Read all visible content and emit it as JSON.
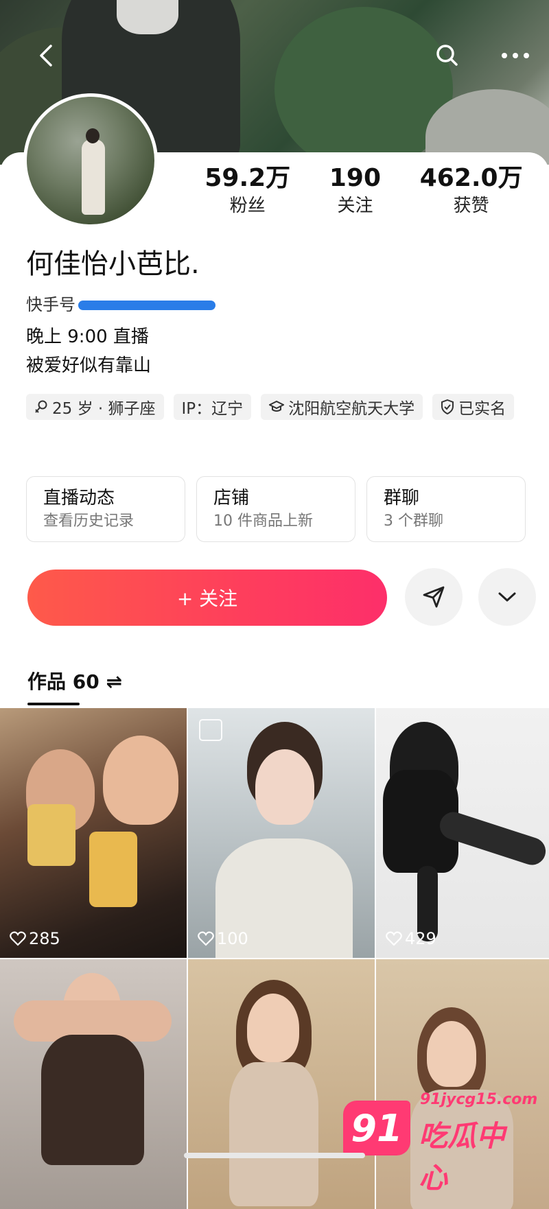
{
  "header": {
    "back_icon": "chevron-left-icon",
    "search_icon": "search-icon",
    "more_icon": "more-dots-icon"
  },
  "profile": {
    "name": "何佳怡小芭比.",
    "kuaishou_id_label": "快手号",
    "bio_lines": [
      "晚上 9:00 直播",
      "被爱好似有靠山"
    ],
    "stats": [
      {
        "value": "59.2万",
        "label": "粉丝"
      },
      {
        "value": "190",
        "label": "关注"
      },
      {
        "value": "462.0万",
        "label": "获赞"
      }
    ],
    "tags": [
      {
        "icon": "gender-female-icon",
        "text": "25 岁 · 狮子座"
      },
      {
        "icon": "",
        "text": "IP：辽宁"
      },
      {
        "icon": "graduation-cap-icon",
        "text": "沈阳航空航天大学"
      },
      {
        "icon": "shield-check-icon",
        "text": "已实名"
      }
    ]
  },
  "cards": [
    {
      "title": "直播动态",
      "subtitle": "查看历史记录"
    },
    {
      "title": "店铺",
      "subtitle": "10 件商品上新"
    },
    {
      "title": "群聊",
      "subtitle": "3 个群聊"
    }
  ],
  "actions": {
    "follow_label": "+ 关注",
    "share_icon": "send-icon",
    "expand_icon": "chevron-down-icon"
  },
  "works": {
    "label": "作品 60 ⇌",
    "items": [
      {
        "likes": "285"
      },
      {
        "likes": "100"
      },
      {
        "likes": "429"
      },
      {
        "likes": ""
      },
      {
        "likes": ""
      },
      {
        "likes": ""
      }
    ]
  },
  "watermark": {
    "badge": "91",
    "url": "91jycg15.com",
    "text": "吃瓜中心"
  },
  "colors": {
    "accent": "#fe3e5c",
    "tag_bg": "#f2f2f2",
    "watermark": "#ff3a73"
  }
}
